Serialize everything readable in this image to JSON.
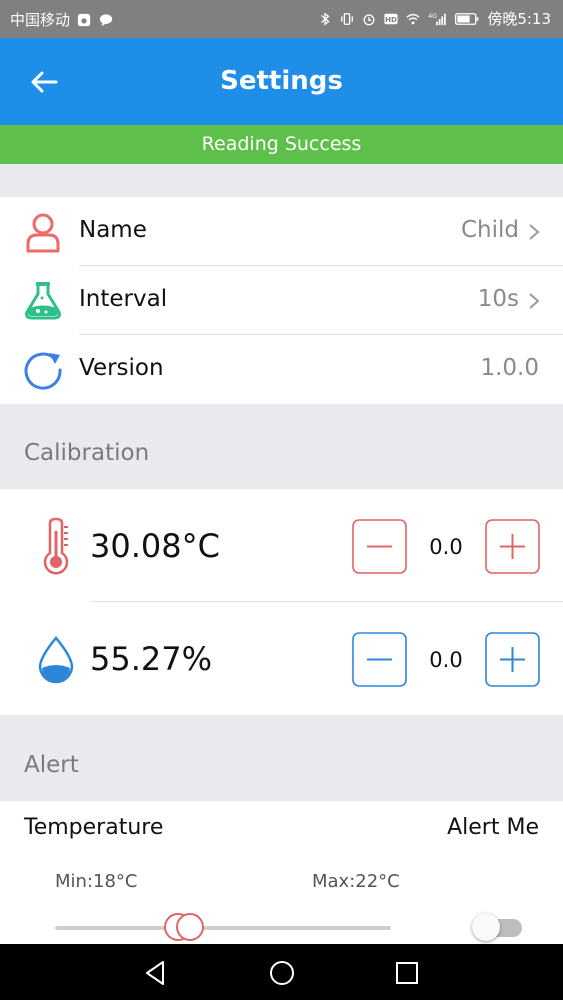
{
  "status_bar": {
    "carrier": "中国移动",
    "time": "傍晚5:13",
    "icons": [
      "baidu-icon",
      "chat-bubble-icon",
      "bluetooth-icon",
      "vibrate-icon",
      "alarm-icon",
      "hd-icon",
      "wifi-icon",
      "signal-4g-icon",
      "battery-icon"
    ]
  },
  "app_bar": {
    "title": "Settings",
    "back_icon": "arrow-left-icon"
  },
  "banner": {
    "text": "Reading Success",
    "color": "#5ec04a"
  },
  "device": {
    "items": [
      {
        "label": "Name",
        "value": "Child",
        "icon": "person-icon",
        "has_chevron": true
      },
      {
        "label": "Interval",
        "value": "10s",
        "icon": "flask-icon",
        "has_chevron": true
      },
      {
        "label": "Version",
        "value": "1.0.0",
        "icon": "refresh-icon",
        "has_chevron": false
      }
    ]
  },
  "calibration": {
    "title": "Calibration",
    "temperature": {
      "reading": "30.08°C",
      "offset": "0.0",
      "icon": "thermometer-icon",
      "color": "#e06464"
    },
    "humidity": {
      "reading": "55.27%",
      "offset": "0.0",
      "icon": "water-drop-icon",
      "color": "#2e86d8"
    }
  },
  "alert": {
    "title": "Alert",
    "temperature_label": "Temperature",
    "alert_me_label": "Alert Me",
    "min_label": "Min:18°C",
    "max_label": "Max:22°C",
    "alert_enabled": false
  },
  "colors": {
    "app_bar": "#1e8ee8",
    "accent_red": "#e06464",
    "accent_blue": "#2e86d8",
    "status_bar": "#808080"
  },
  "nav_bar": {
    "icons": [
      "back-triangle-icon",
      "home-circle-icon",
      "recents-square-icon"
    ]
  }
}
